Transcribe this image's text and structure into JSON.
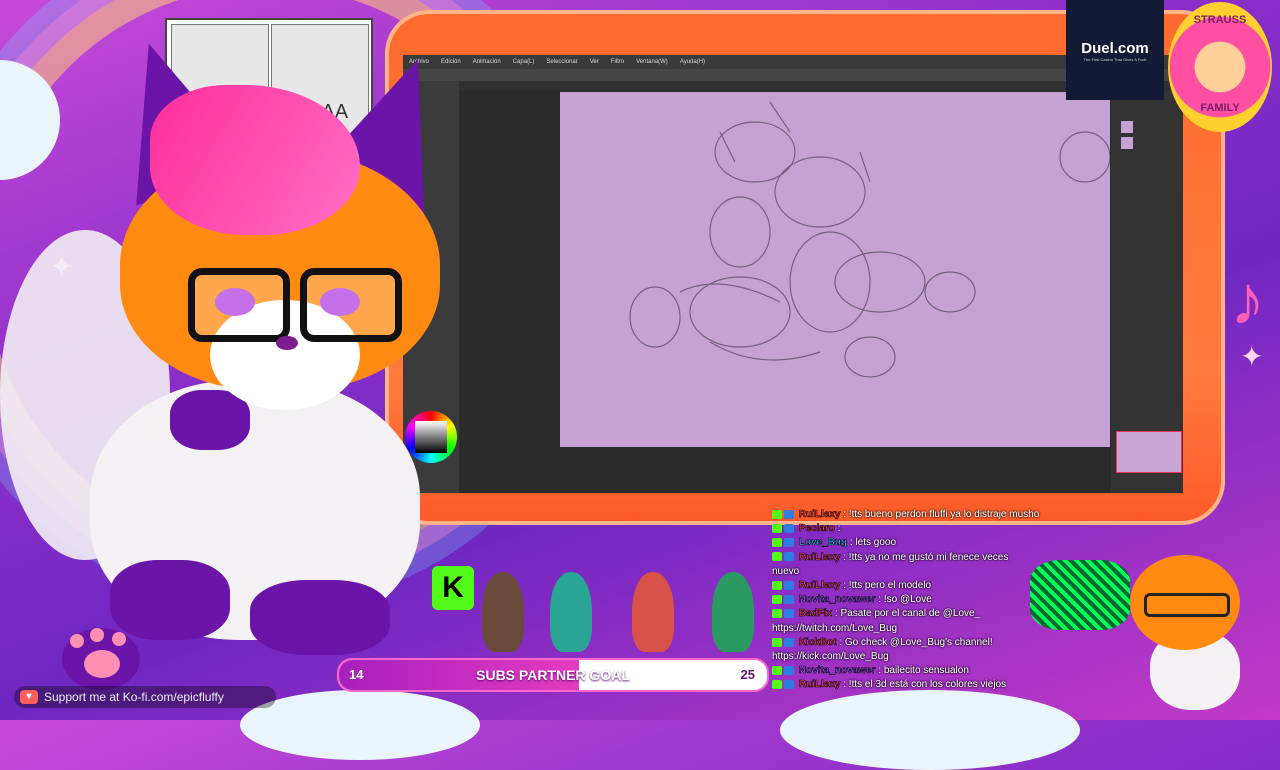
{
  "app": {
    "menu": [
      "Archivo",
      "Edición",
      "Animación",
      "Capa(L)",
      "Seleccionar",
      "Ver",
      "Filtro",
      "Ventana(W)",
      "Ayuda(H)"
    ]
  },
  "sponsor": {
    "name": "Duel.com",
    "tagline": "The First Casino That Gives A Fuck"
  },
  "badge": {
    "top": "STRAUSS",
    "bottom": "FAMILY"
  },
  "meme": {
    "text_left": "A",
    "text_right": "AAA AA"
  },
  "kofi": {
    "text": "Support me at Ko-fi.com/epicfluffy"
  },
  "goal": {
    "label": "SUBS PARTNER GOAL",
    "current": "14",
    "target": "25",
    "progress": 0.56
  },
  "chat": [
    {
      "user": "RuiLlexy",
      "text": ": !tts bueno perdon fluffi ya lo distraje musho",
      "color": "#ff4a4a"
    },
    {
      "user": "Peclaro",
      "text": ":",
      "color": "#ff4a4a"
    },
    {
      "user": "Love_Bug",
      "text": ": lets gooo",
      "color": "#2fd6ff"
    },
    {
      "user": "RuiLlexy",
      "text": ": !tts ya no me gustó mi fenece veces",
      "color": "#ff4a4a"
    },
    {
      "user": "",
      "text": "nuevo",
      "color": "#ffffff"
    },
    {
      "user": "RuiLlexy",
      "text": ": !tts pero el modelo",
      "color": "#ff4a4a"
    },
    {
      "user": "Novita_novawer",
      "text": ": !so @Love",
      "color": "#9b5cff"
    },
    {
      "user": "BadFix",
      "text": ": Pasate por el canal de @Love_",
      "color": "#ff4a4a"
    },
    {
      "user": "",
      "text": "https://twitch.com/Love_Bug",
      "color": "#ffffff"
    },
    {
      "user": "KickBot",
      "text": ": Go check @Love_Bug's channel!",
      "color": "#ff4a4a"
    },
    {
      "user": "",
      "text": "https://kick.com/Love_Bug",
      "color": "#ffffff"
    },
    {
      "user": "Novita_novawer",
      "text": ": bailecito sensualon",
      "color": "#9b5cff"
    },
    {
      "user": "RuiLlexy",
      "text": ": !tts el 3d está con los colores viejos",
      "color": "#ff4a4a"
    }
  ],
  "icons": [
    "ko-fi-icon",
    "kick-icon",
    "color-wheel"
  ]
}
